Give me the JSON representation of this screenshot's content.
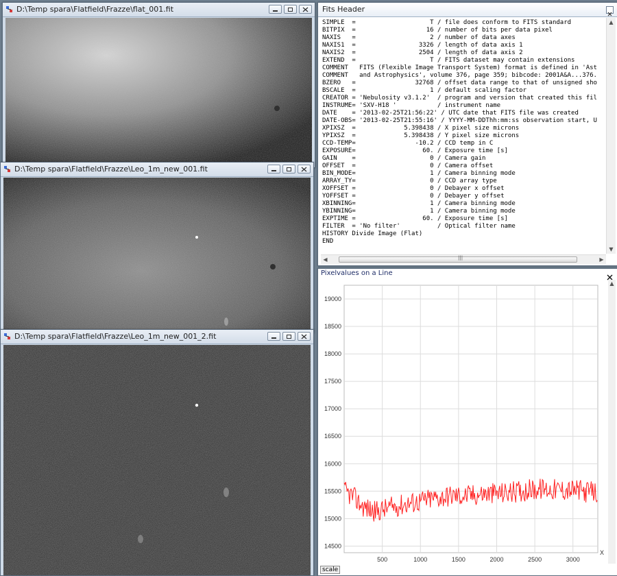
{
  "windows": {
    "flat": {
      "title": "D:\\Temp spara\\Flatfield\\Frazze\\flat_001.fit"
    },
    "leo1": {
      "title": "D:\\Temp spara\\Flatfield\\Frazze\\Leo_1m_new_001.fit"
    },
    "leo2": {
      "title": "D:\\Temp spara\\Flatfield\\Frazze\\Leo_1m_new_001_2.fit"
    }
  },
  "fits_header": {
    "title": "Fits Header",
    "lines": [
      "SIMPLE  =                    T / file does conform to FITS standard",
      "BITPIX  =                   16 / number of bits per data pixel",
      "NAXIS   =                    2 / number of data axes",
      "NAXIS1  =                 3326 / length of data axis 1",
      "NAXIS2  =                 2504 / length of data axis 2",
      "EXTEND  =                    T / FITS dataset may contain extensions",
      "COMMENT   FITS (Flexible Image Transport System) format is defined in 'Ast",
      "COMMENT   and Astrophysics', volume 376, page 359; bibcode: 2001A&A...376.",
      "BZERO   =                32768 / offset data range to that of unsigned sho",
      "BSCALE  =                    1 / default scaling factor",
      "CREATOR = 'Nebulosity v3.1.2'  / program and version that created this fil",
      "INSTRUME= 'SXV-H18 '           / instrument name",
      "DATE    = '2013-02-25T21:56:22' / UTC date that FITS file was created",
      "DATE-OBS= '2013-02-25T21:55:16' / YYYY-MM-DDThh:mm:ss observation start, U",
      "XPIXSZ  =             5.398438 / X pixel size microns",
      "YPIXSZ  =             5.398438 / Y pixel size microns",
      "CCD-TEMP=                -10.2 / CCD temp in C",
      "EXPOSURE=                  60. / Exposure time [s]",
      "GAIN    =                    0 / Camera gain",
      "OFFSET  =                    0 / Camera offset",
      "BIN_MODE=                    1 / Camera binning mode",
      "ARRAY_TY=                    0 / CCD array type",
      "XOFFSET =                    0 / Debayer x offset",
      "YOFFSET =                    0 / Debayer y offset",
      "XBINNING=                    1 / Camera binning mode",
      "YBINNING=                    1 / Camera binning mode",
      "EXPTIME =                  60. / Exposure time [s]",
      "FILTER  = 'No filter'          / Optical filter name",
      "HISTORY Divide Image (Flat)",
      "END"
    ]
  },
  "scrollbar": {
    "grip": "|||"
  },
  "pixel_chart": {
    "title": "Pixelvalues on a Line",
    "scale_button": "scale",
    "accent": "#ff2020",
    "axis_x_marker": "X"
  },
  "chart_data": {
    "type": "line",
    "title": "Pixelvalues on a Line",
    "xlim": [
      0,
      3326
    ],
    "ylim": [
      14380,
      19250
    ],
    "x_ticks": [
      500,
      1000,
      1500,
      2000,
      2500,
      3000
    ],
    "y_ticks": [
      14500,
      15000,
      15500,
      16000,
      16500,
      17000,
      17500,
      18000,
      18500,
      19000
    ],
    "grid": true,
    "series": [
      {
        "color": "#ff2020",
        "x_step": 10,
        "trend": [
          [
            0,
            15500
          ],
          [
            100,
            15420
          ],
          [
            250,
            15220
          ],
          [
            400,
            15130
          ],
          [
            600,
            15200
          ],
          [
            800,
            15270
          ],
          [
            1000,
            15320
          ],
          [
            1200,
            15380
          ],
          [
            1400,
            15420
          ],
          [
            1600,
            15420
          ],
          [
            1800,
            15450
          ],
          [
            2000,
            15460
          ],
          [
            2200,
            15480
          ],
          [
            2400,
            15520
          ],
          [
            2600,
            15540
          ],
          [
            2800,
            15530
          ],
          [
            3000,
            15520
          ],
          [
            3200,
            15490
          ],
          [
            3326,
            15480
          ]
        ],
        "noise_amplitude": 200
      }
    ]
  }
}
